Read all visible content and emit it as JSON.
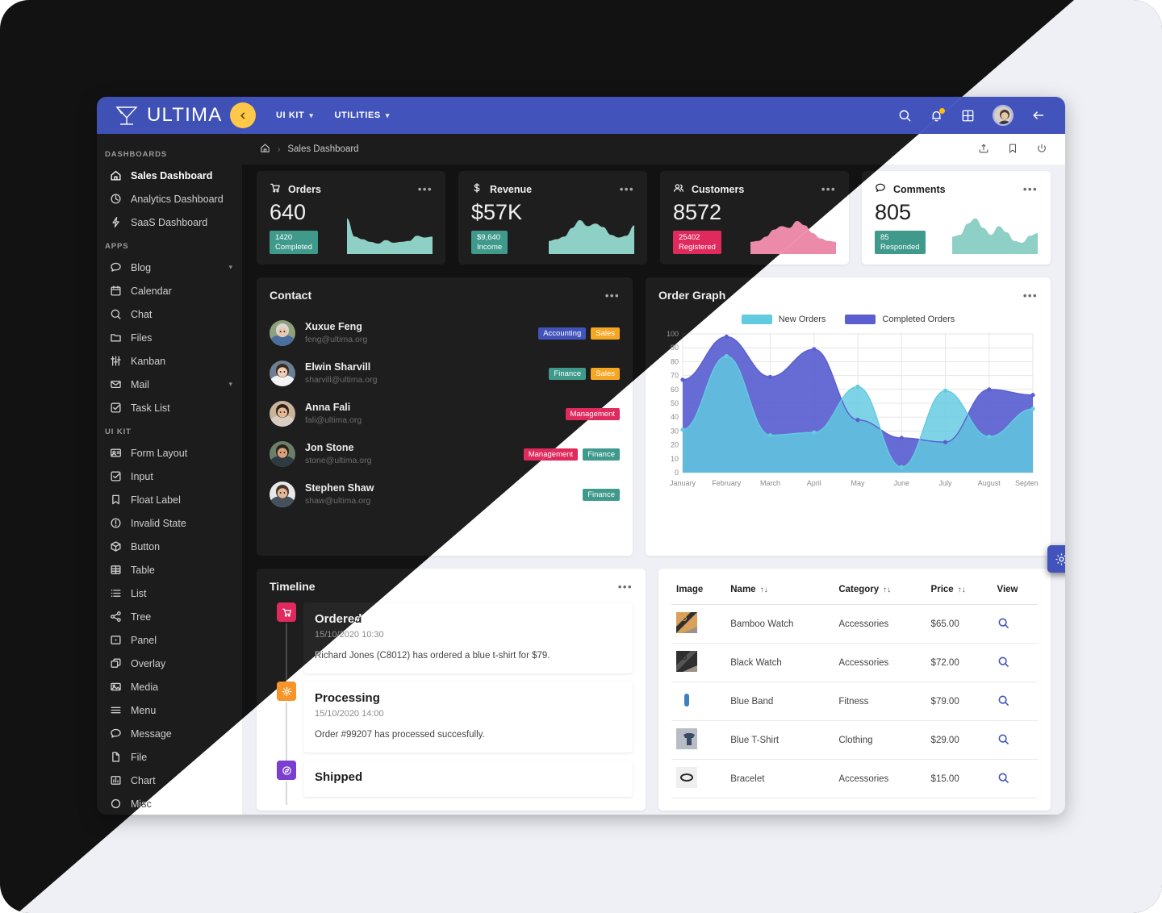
{
  "brand": {
    "name": "ULTIMA"
  },
  "topbar": {
    "menus": [
      {
        "label": "UI KIT",
        "icon": "chevron-down-icon"
      },
      {
        "label": "UTILITIES",
        "icon": "chevron-down-icon"
      }
    ],
    "icons": [
      "search-icon",
      "bell-icon",
      "grid-icon",
      "avatar",
      "arrow-left-icon"
    ],
    "collapse_icon": "chevron-left-icon"
  },
  "breadcrumb": {
    "home_icon": "home-icon",
    "separator": "›",
    "current": "Sales Dashboard",
    "actions": [
      "share-icon",
      "bookmark-icon",
      "power-icon"
    ]
  },
  "sidebar": {
    "sections": [
      {
        "title": "DASHBOARDS",
        "items": [
          {
            "label": "Sales Dashboard",
            "icon": "home-icon",
            "active": true
          },
          {
            "label": "Analytics Dashboard",
            "icon": "clock-icon",
            "active": false
          },
          {
            "label": "SaaS Dashboard",
            "icon": "bolt-icon",
            "active": false
          }
        ]
      },
      {
        "title": "APPS",
        "items": [
          {
            "label": "Blog",
            "icon": "comment-icon",
            "expandable": true
          },
          {
            "label": "Calendar",
            "icon": "calendar-icon"
          },
          {
            "label": "Chat",
            "icon": "chat-icon"
          },
          {
            "label": "Files",
            "icon": "folder-icon"
          },
          {
            "label": "Kanban",
            "icon": "sliders-icon"
          },
          {
            "label": "Mail",
            "icon": "envelope-icon",
            "expandable": true
          },
          {
            "label": "Task List",
            "icon": "check-square-icon"
          }
        ]
      },
      {
        "title": "UI KIT",
        "items": [
          {
            "label": "Form Layout",
            "icon": "id-card-icon"
          },
          {
            "label": "Input",
            "icon": "check-square-icon"
          },
          {
            "label": "Float Label",
            "icon": "bookmark-icon"
          },
          {
            "label": "Invalid State",
            "icon": "exclamation-circle-icon"
          },
          {
            "label": "Button",
            "icon": "box-icon"
          },
          {
            "label": "Table",
            "icon": "table-icon"
          },
          {
            "label": "List",
            "icon": "list-icon"
          },
          {
            "label": "Tree",
            "icon": "share-nodes-icon"
          },
          {
            "label": "Panel",
            "icon": "panel-icon"
          },
          {
            "label": "Overlay",
            "icon": "clone-icon"
          },
          {
            "label": "Media",
            "icon": "image-icon"
          },
          {
            "label": "Menu",
            "icon": "bars-icon"
          },
          {
            "label": "Message",
            "icon": "comment-icon"
          },
          {
            "label": "File",
            "icon": "file-icon"
          },
          {
            "label": "Chart",
            "icon": "chart-bar-icon"
          },
          {
            "label": "Misc",
            "icon": "circle-icon"
          }
        ]
      }
    ]
  },
  "kpis": [
    {
      "title": "Orders",
      "icon": "cart-icon",
      "value": "640",
      "chip_value": "1420",
      "chip_label": "Completed",
      "chip_color": "#3f9a8c",
      "spark_color": "#8fd0c6"
    },
    {
      "title": "Revenue",
      "icon": "dollar-icon",
      "value": "$57K",
      "chip_value": "$9,640",
      "chip_label": "Income",
      "chip_color": "#3f9a8c",
      "spark_color": "#8fd0c6"
    },
    {
      "title": "Customers",
      "icon": "users-icon",
      "value": "8572",
      "chip_value": "25402",
      "chip_label": "Registered",
      "chip_color": "#e0295c",
      "spark_color": "#ec8aaa"
    },
    {
      "title": "Comments",
      "icon": "comment-icon",
      "value": "805",
      "chip_value": "85",
      "chip_label": "Responded",
      "chip_color": "#3f9a8c",
      "spark_color": "#8fd0c6"
    }
  ],
  "contact": {
    "title": "Contact",
    "menu_icon": "ellipsis-icon",
    "people": [
      {
        "name": "Xuxue Feng",
        "email": "feng@ultima.org",
        "tags": [
          {
            "label": "Accounting",
            "color": "#4254bb"
          },
          {
            "label": "Sales",
            "color": "#f5a623"
          }
        ]
      },
      {
        "name": "Elwin Sharvill",
        "email": "sharvill@ultima.org",
        "tags": [
          {
            "label": "Finance",
            "color": "#3f9a8c"
          },
          {
            "label": "Sales",
            "color": "#f5a623"
          }
        ]
      },
      {
        "name": "Anna Fali",
        "email": "fali@ultima.org",
        "tags": [
          {
            "label": "Management",
            "color": "#e0295c"
          }
        ]
      },
      {
        "name": "Jon Stone",
        "email": "stone@ultima.org",
        "tags": [
          {
            "label": "Management",
            "color": "#e0295c"
          },
          {
            "label": "Finance",
            "color": "#3f9a8c"
          }
        ]
      },
      {
        "name": "Stephen Shaw",
        "email": "shaw@ultima.org",
        "tags": [
          {
            "label": "Finance",
            "color": "#3f9a8c"
          }
        ]
      }
    ]
  },
  "order_graph": {
    "title": "Order Graph",
    "menu_icon": "ellipsis-icon"
  },
  "chart_data": {
    "type": "area",
    "title": "Order Graph",
    "xlabel": "",
    "ylabel": "",
    "ylim": [
      0,
      100
    ],
    "yticks": [
      0,
      10,
      20,
      30,
      40,
      50,
      60,
      70,
      80,
      90,
      100
    ],
    "grid": true,
    "legend_position": "top",
    "categories": [
      "January",
      "February",
      "March",
      "April",
      "May",
      "June",
      "July",
      "August",
      "September"
    ],
    "series": [
      {
        "name": "New Orders",
        "color": "#62cbe0",
        "values": [
          31,
          84,
          27,
          29,
          62,
          4,
          59,
          26,
          46
        ]
      },
      {
        "name": "Completed Orders",
        "color": "#5a5ed0",
        "values": [
          67,
          98,
          69,
          89,
          38,
          25,
          22,
          60,
          56
        ]
      }
    ]
  },
  "timeline": {
    "title": "Timeline",
    "menu_icon": "ellipsis-icon",
    "events": [
      {
        "title": "Ordered",
        "date": "15/10/2020 10:30",
        "text": "Richard Jones (C8012) has ordered a blue t-shirt for $79.",
        "icon": "cart-icon",
        "color": "#e0295c"
      },
      {
        "title": "Processing",
        "date": "15/10/2020 14:00",
        "text": "Order #99207 has processed succesfully.",
        "icon": "gear-icon",
        "color": "#f5952a"
      },
      {
        "title": "Shipped",
        "date": "",
        "text": "",
        "icon": "compass-icon",
        "color": "#7a3fd0"
      }
    ]
  },
  "product_table": {
    "columns": [
      {
        "label": "Image",
        "sortable": false
      },
      {
        "label": "Name",
        "sortable": true,
        "sort_icon": "sort-icon"
      },
      {
        "label": "Category",
        "sortable": true,
        "sort_icon": "sort-icon"
      },
      {
        "label": "Price",
        "sortable": true,
        "sort_icon": "sort-icon"
      },
      {
        "label": "View",
        "sortable": false
      }
    ],
    "rows": [
      {
        "name": "Bamboo Watch",
        "category": "Accessories",
        "price": "$65.00",
        "view_icon": "search-icon"
      },
      {
        "name": "Black Watch",
        "category": "Accessories",
        "price": "$72.00",
        "view_icon": "search-icon"
      },
      {
        "name": "Blue Band",
        "category": "Fitness",
        "price": "$79.00",
        "view_icon": "search-icon"
      },
      {
        "name": "Blue T-Shirt",
        "category": "Clothing",
        "price": "$29.00",
        "view_icon": "search-icon"
      },
      {
        "name": "Bracelet",
        "category": "Accessories",
        "price": "$15.00",
        "view_icon": "search-icon"
      }
    ]
  },
  "fab": {
    "icon": "gear-icon"
  },
  "colors": {
    "primary": "#4254bb",
    "accent": "#ffc848",
    "teal": "#3f9a8c",
    "pink": "#e0295c",
    "orange": "#f5a623"
  }
}
